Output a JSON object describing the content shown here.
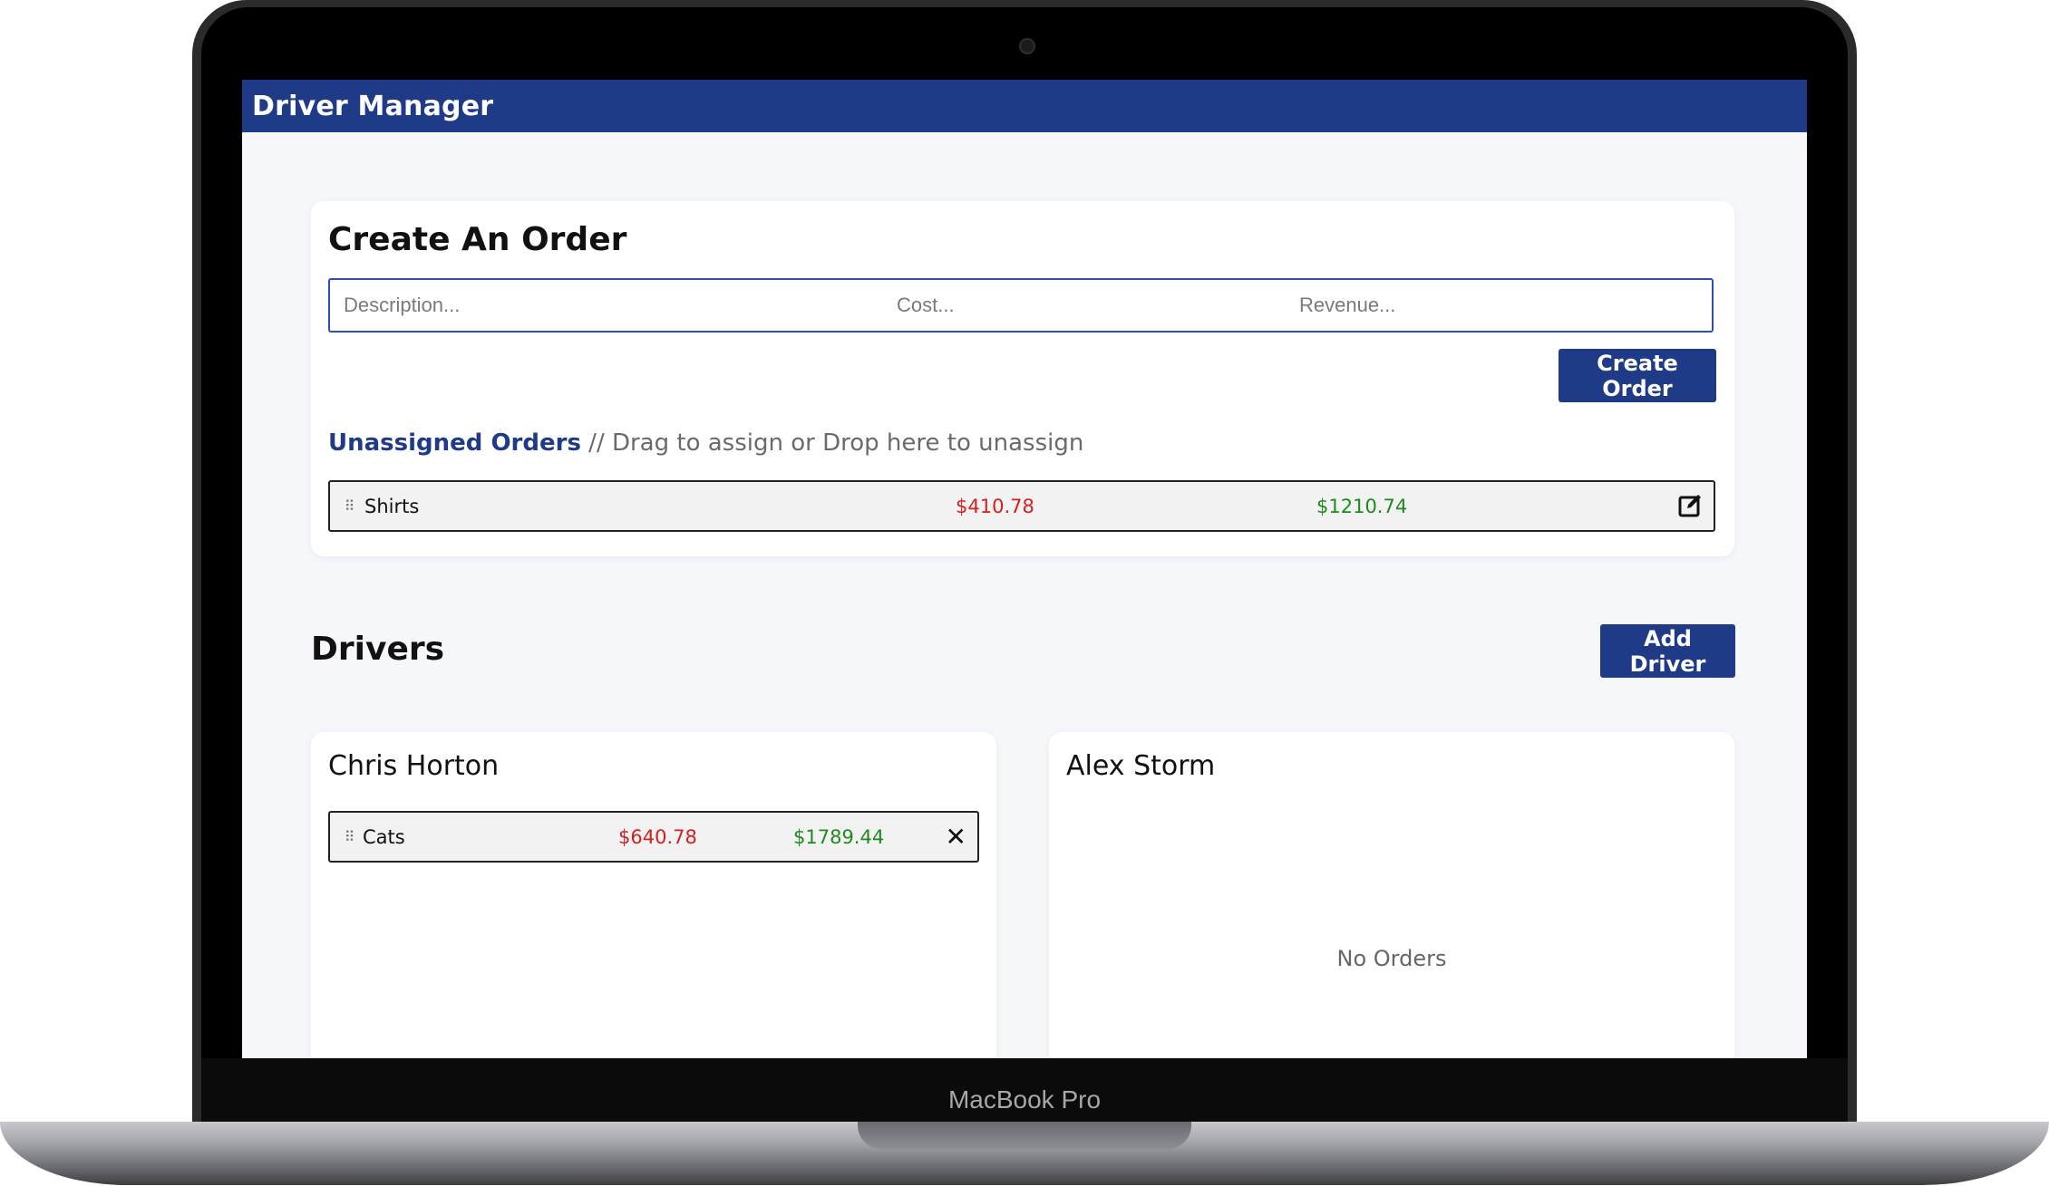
{
  "app": {
    "title": "Driver Manager"
  },
  "device": {
    "label": "MacBook Pro"
  },
  "create_order": {
    "title": "Create An Order",
    "description_placeholder": "Description...",
    "cost_placeholder": "Cost...",
    "revenue_placeholder": "Revenue...",
    "button_label": "Create Order"
  },
  "unassigned": {
    "title": "Unassigned Orders",
    "hint": " // Drag to assign or Drop here to unassign",
    "orders": [
      {
        "description": "Shirts",
        "cost": "$410.78",
        "revenue": "$1210.74"
      }
    ]
  },
  "drivers": {
    "title": "Drivers",
    "add_button_label": "Add Driver",
    "list": [
      {
        "name": "Chris Horton",
        "orders": [
          {
            "description": "Cats",
            "cost": "$640.78",
            "revenue": "$1789.44"
          }
        ]
      },
      {
        "name": "Alex Storm",
        "orders": [],
        "empty_text": "No Orders"
      }
    ]
  },
  "icons": {
    "drag_handle": "⠿",
    "edit": "edit-icon",
    "remove": "✕"
  },
  "colors": {
    "brand": "#1f3a87",
    "cost": "#d42020",
    "revenue": "#1f8a1f",
    "background": "#f6f7fa"
  }
}
